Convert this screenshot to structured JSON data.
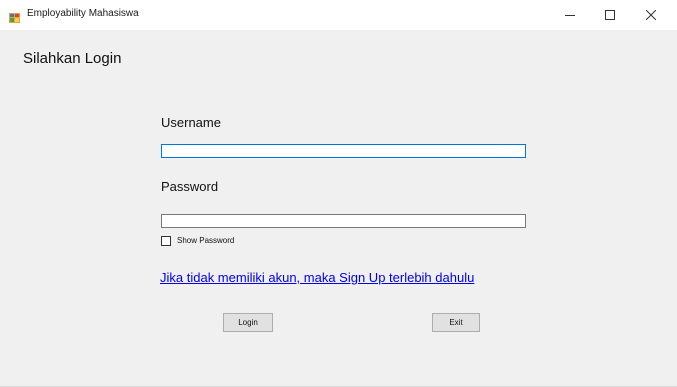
{
  "window": {
    "title": "Employability Mahasiswa",
    "controls": {
      "minimize": "minimize-icon",
      "maximize": "maximize-icon",
      "close": "close-icon"
    }
  },
  "form": {
    "heading": "Silahkan Login",
    "username_label": "Username",
    "username_value": "",
    "password_label": "Password",
    "password_value": "",
    "show_password_label": "Show Password",
    "show_password_checked": false,
    "signup_link": "Jika tidak memiliki akun, maka Sign Up terlebih dahulu",
    "login_button": "Login",
    "exit_button": "Exit"
  },
  "colors": {
    "window_background": "#f0f0f0",
    "titlebar_background": "#ffffff",
    "focus_border": "#0078d7",
    "link": "#0000ee",
    "button_face": "#e1e1e1"
  }
}
